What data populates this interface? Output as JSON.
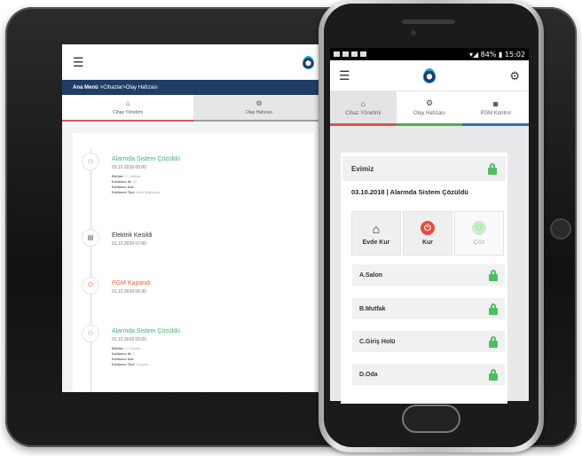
{
  "tablet": {
    "breadcrumb": {
      "home": "Ana Menü",
      "separator1": " > ",
      "section": "Cihazlar",
      "separator2": " > ",
      "current": "Olay Hafızası"
    },
    "tabs": [
      {
        "label": "Cihaz Yönetimi",
        "icon": "home-icon"
      },
      {
        "label": "Olay Hafızası",
        "icon": "gear-icon"
      }
    ],
    "events": [
      {
        "title": "Alarmda Sistem Çözüldü",
        "date": "03.10.2018 00:00",
        "color": "#3cb371",
        "icon": "network-icon",
        "details": [
          {
            "k": "Bölüm:",
            "v": " 2 / Mutfak"
          },
          {
            "k": "Kullanıcı Id:",
            "v": " 12"
          },
          {
            "k": "Kullanıcı Adı:",
            "v": ""
          },
          {
            "k": "Kullanıcı Tipi:",
            "v": " Uzak Bilgisayar"
          }
        ]
      },
      {
        "title": "Elektrik Kesildi",
        "date": "01.10.2018 07:00",
        "color": "#333333",
        "icon": "plug-icon",
        "details": []
      },
      {
        "title": "PGM Kapandı",
        "date": "01.10.2018 06:30",
        "color": "#e0643c",
        "icon": "power-icon",
        "details": []
      },
      {
        "title": "Alarmda Sistem Çözüldü",
        "date": "01.10.2018 05:00",
        "color": "#3cb371",
        "icon": "network-icon",
        "details": [
          {
            "k": "Bölüm:",
            "v": " 2 / Mutfak"
          },
          {
            "k": "Kullanıcı Id:",
            "v": " 1"
          },
          {
            "k": "Kullanıcı Adı:",
            "v": ""
          },
          {
            "k": "Kullanıcı Tipi:",
            "v": " Keypad"
          }
        ]
      }
    ]
  },
  "phone": {
    "status_bar": {
      "battery": "84%",
      "time": "15:02"
    },
    "tabs": [
      {
        "label": "Cihaz Yönetimi",
        "icon": "home-icon"
      },
      {
        "label": "Olay Hafızası",
        "icon": "gear-icon"
      },
      {
        "label": "PGM Kontrol",
        "icon": "camera-icon"
      }
    ],
    "site_name": "Evimiz",
    "status_line": "03.10.2018 | Alarmda Sistem Çözüldü",
    "actions": [
      {
        "label": "Evde Kur",
        "icon": "home-arm-icon"
      },
      {
        "label": "Kur",
        "icon": "arm-icon"
      },
      {
        "label": "Çöz",
        "icon": "disarm-icon"
      }
    ],
    "zones": [
      "A.Salon",
      "B.Mutfak",
      "C.Giriş Holü",
      "D.Oda"
    ]
  },
  "colors": {
    "brand_navy": "#1f3d66",
    "accent_red": "#d9534f",
    "accent_green": "#4caf50",
    "accent_blue": "#2f6fbf",
    "lock_green": "#4cc060"
  }
}
